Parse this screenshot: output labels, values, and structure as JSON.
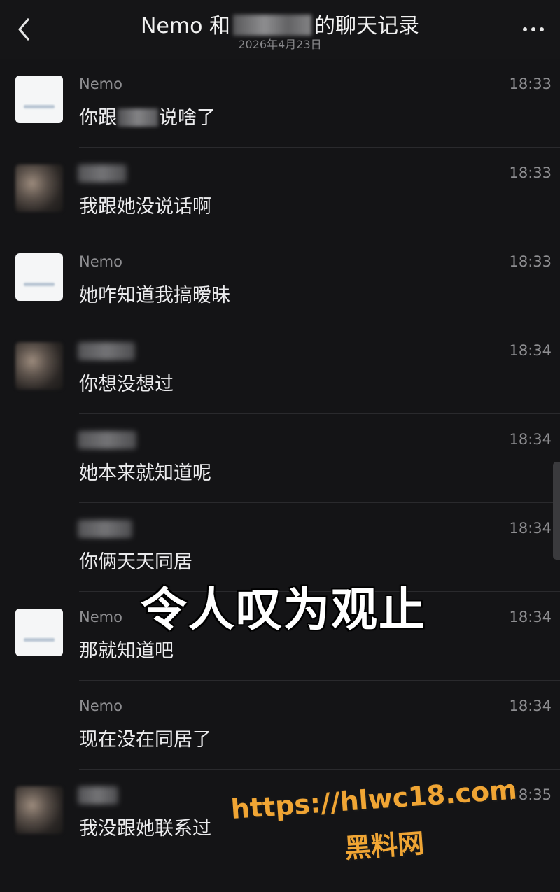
{
  "header": {
    "title_prefix": "Nemo 和",
    "title_suffix": "的聊天记录",
    "date": "2026年4月23日",
    "back_icon": "chevron-left-icon",
    "more_icon": "more-dots-icon"
  },
  "messages": [
    {
      "sender": "Nemo",
      "time": "18:33",
      "text_before": "你跟",
      "text_after": "说啥了"
    },
    {
      "sender": "",
      "time": "18:33",
      "text": "我跟她没说话啊"
    },
    {
      "sender": "Nemo",
      "time": "18:33",
      "text": "她咋知道我搞暧昧"
    },
    {
      "sender": "",
      "time": "18:34",
      "text": "你想没想过"
    },
    {
      "sender": "",
      "time": "18:34",
      "text": "她本来就知道呢"
    },
    {
      "sender": "",
      "time": "18:34",
      "text": "你俩天天同居"
    },
    {
      "sender": "Nemo",
      "time": "18:34",
      "text": "那就知道吧"
    },
    {
      "sender": "Nemo",
      "time": "18:34",
      "text": "现在没在同居了"
    },
    {
      "sender": "",
      "time": "18:35",
      "text": "我没跟她联系过"
    }
  ],
  "overlay": {
    "caption": "令人叹为观止",
    "watermark_url": "https://hlwc18.com",
    "watermark_name": "黑料网",
    "watermark_color": "#f0a534"
  }
}
